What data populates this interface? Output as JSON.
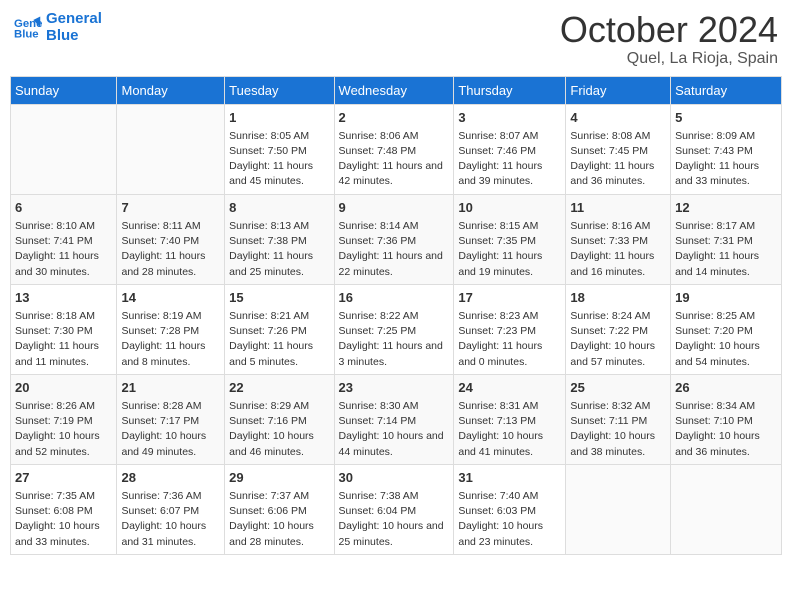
{
  "header": {
    "logo_line1": "General",
    "logo_line2": "Blue",
    "month_title": "October 2024",
    "location": "Quel, La Rioja, Spain"
  },
  "weekdays": [
    "Sunday",
    "Monday",
    "Tuesday",
    "Wednesday",
    "Thursday",
    "Friday",
    "Saturday"
  ],
  "weeks": [
    [
      {
        "day": "",
        "info": ""
      },
      {
        "day": "",
        "info": ""
      },
      {
        "day": "1",
        "info": "Sunrise: 8:05 AM\nSunset: 7:50 PM\nDaylight: 11 hours and 45 minutes."
      },
      {
        "day": "2",
        "info": "Sunrise: 8:06 AM\nSunset: 7:48 PM\nDaylight: 11 hours and 42 minutes."
      },
      {
        "day": "3",
        "info": "Sunrise: 8:07 AM\nSunset: 7:46 PM\nDaylight: 11 hours and 39 minutes."
      },
      {
        "day": "4",
        "info": "Sunrise: 8:08 AM\nSunset: 7:45 PM\nDaylight: 11 hours and 36 minutes."
      },
      {
        "day": "5",
        "info": "Sunrise: 8:09 AM\nSunset: 7:43 PM\nDaylight: 11 hours and 33 minutes."
      }
    ],
    [
      {
        "day": "6",
        "info": "Sunrise: 8:10 AM\nSunset: 7:41 PM\nDaylight: 11 hours and 30 minutes."
      },
      {
        "day": "7",
        "info": "Sunrise: 8:11 AM\nSunset: 7:40 PM\nDaylight: 11 hours and 28 minutes."
      },
      {
        "day": "8",
        "info": "Sunrise: 8:13 AM\nSunset: 7:38 PM\nDaylight: 11 hours and 25 minutes."
      },
      {
        "day": "9",
        "info": "Sunrise: 8:14 AM\nSunset: 7:36 PM\nDaylight: 11 hours and 22 minutes."
      },
      {
        "day": "10",
        "info": "Sunrise: 8:15 AM\nSunset: 7:35 PM\nDaylight: 11 hours and 19 minutes."
      },
      {
        "day": "11",
        "info": "Sunrise: 8:16 AM\nSunset: 7:33 PM\nDaylight: 11 hours and 16 minutes."
      },
      {
        "day": "12",
        "info": "Sunrise: 8:17 AM\nSunset: 7:31 PM\nDaylight: 11 hours and 14 minutes."
      }
    ],
    [
      {
        "day": "13",
        "info": "Sunrise: 8:18 AM\nSunset: 7:30 PM\nDaylight: 11 hours and 11 minutes."
      },
      {
        "day": "14",
        "info": "Sunrise: 8:19 AM\nSunset: 7:28 PM\nDaylight: 11 hours and 8 minutes."
      },
      {
        "day": "15",
        "info": "Sunrise: 8:21 AM\nSunset: 7:26 PM\nDaylight: 11 hours and 5 minutes."
      },
      {
        "day": "16",
        "info": "Sunrise: 8:22 AM\nSunset: 7:25 PM\nDaylight: 11 hours and 3 minutes."
      },
      {
        "day": "17",
        "info": "Sunrise: 8:23 AM\nSunset: 7:23 PM\nDaylight: 11 hours and 0 minutes."
      },
      {
        "day": "18",
        "info": "Sunrise: 8:24 AM\nSunset: 7:22 PM\nDaylight: 10 hours and 57 minutes."
      },
      {
        "day": "19",
        "info": "Sunrise: 8:25 AM\nSunset: 7:20 PM\nDaylight: 10 hours and 54 minutes."
      }
    ],
    [
      {
        "day": "20",
        "info": "Sunrise: 8:26 AM\nSunset: 7:19 PM\nDaylight: 10 hours and 52 minutes."
      },
      {
        "day": "21",
        "info": "Sunrise: 8:28 AM\nSunset: 7:17 PM\nDaylight: 10 hours and 49 minutes."
      },
      {
        "day": "22",
        "info": "Sunrise: 8:29 AM\nSunset: 7:16 PM\nDaylight: 10 hours and 46 minutes."
      },
      {
        "day": "23",
        "info": "Sunrise: 8:30 AM\nSunset: 7:14 PM\nDaylight: 10 hours and 44 minutes."
      },
      {
        "day": "24",
        "info": "Sunrise: 8:31 AM\nSunset: 7:13 PM\nDaylight: 10 hours and 41 minutes."
      },
      {
        "day": "25",
        "info": "Sunrise: 8:32 AM\nSunset: 7:11 PM\nDaylight: 10 hours and 38 minutes."
      },
      {
        "day": "26",
        "info": "Sunrise: 8:34 AM\nSunset: 7:10 PM\nDaylight: 10 hours and 36 minutes."
      }
    ],
    [
      {
        "day": "27",
        "info": "Sunrise: 7:35 AM\nSunset: 6:08 PM\nDaylight: 10 hours and 33 minutes."
      },
      {
        "day": "28",
        "info": "Sunrise: 7:36 AM\nSunset: 6:07 PM\nDaylight: 10 hours and 31 minutes."
      },
      {
        "day": "29",
        "info": "Sunrise: 7:37 AM\nSunset: 6:06 PM\nDaylight: 10 hours and 28 minutes."
      },
      {
        "day": "30",
        "info": "Sunrise: 7:38 AM\nSunset: 6:04 PM\nDaylight: 10 hours and 25 minutes."
      },
      {
        "day": "31",
        "info": "Sunrise: 7:40 AM\nSunset: 6:03 PM\nDaylight: 10 hours and 23 minutes."
      },
      {
        "day": "",
        "info": ""
      },
      {
        "day": "",
        "info": ""
      }
    ]
  ]
}
